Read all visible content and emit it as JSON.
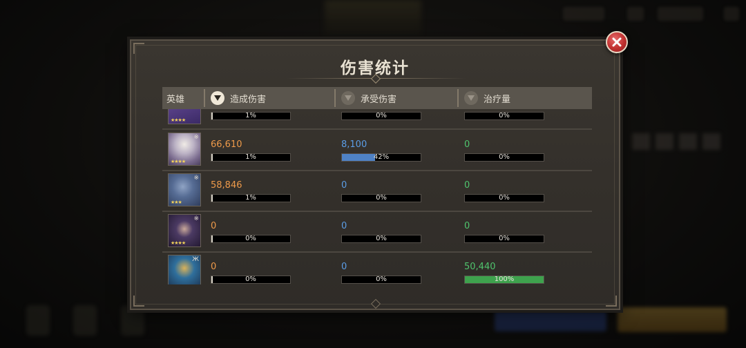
{
  "title": "伤害统计",
  "columns": {
    "hero": "英雄",
    "damage_dealt": "造成伤害",
    "damage_taken": "承受伤害",
    "healing": "治疗量"
  },
  "rows": [
    {
      "portrait_icon": "hero-portrait-purple",
      "stars": "★★★★",
      "damage_dealt": "",
      "damage_dealt_pct": "1%",
      "damage_dealt_fill": 0.01,
      "damage_taken": "",
      "damage_taken_pct": "0%",
      "damage_taken_fill": 0,
      "healing": "",
      "healing_pct": "0%",
      "healing_fill": 0
    },
    {
      "portrait_icon": "hero-portrait-white-hair",
      "stars": "★★★★",
      "badge": "※",
      "damage_dealt": "66,610",
      "damage_dealt_pct": "1%",
      "damage_dealt_fill": 0.01,
      "damage_taken": "8,100",
      "damage_taken_pct": "42%",
      "damage_taken_fill": 0.42,
      "healing": "0",
      "healing_pct": "0%",
      "healing_fill": 0
    },
    {
      "portrait_icon": "hero-portrait-blue-creature",
      "stars": "★★★",
      "badge": "※",
      "damage_dealt": "58,846",
      "damage_dealt_pct": "1%",
      "damage_dealt_fill": 0.01,
      "damage_taken": "0",
      "damage_taken_pct": "0%",
      "damage_taken_fill": 0,
      "healing": "0",
      "healing_pct": "0%",
      "healing_fill": 0
    },
    {
      "portrait_icon": "hero-portrait-hooded",
      "stars": "★★★★",
      "badge": "※",
      "damage_dealt": "0",
      "damage_dealt_pct": "0%",
      "damage_dealt_fill": 0,
      "damage_taken": "0",
      "damage_taken_pct": "0%",
      "damage_taken_fill": 0,
      "healing": "0",
      "healing_pct": "0%",
      "healing_fill": 0
    },
    {
      "portrait_icon": "hero-portrait-armored",
      "stars": "",
      "badge": "Ж",
      "damage_dealt": "0",
      "damage_dealt_pct": "0%",
      "damage_dealt_fill": 0,
      "damage_taken": "0",
      "damage_taken_pct": "0%",
      "damage_taken_fill": 0,
      "healing": "50,440",
      "healing_pct": "100%",
      "healing_fill": 1
    }
  ],
  "colors": {
    "damage_dealt": "#ee9a4a",
    "damage_taken": "#5b9de6",
    "healing": "#4fc36d"
  }
}
